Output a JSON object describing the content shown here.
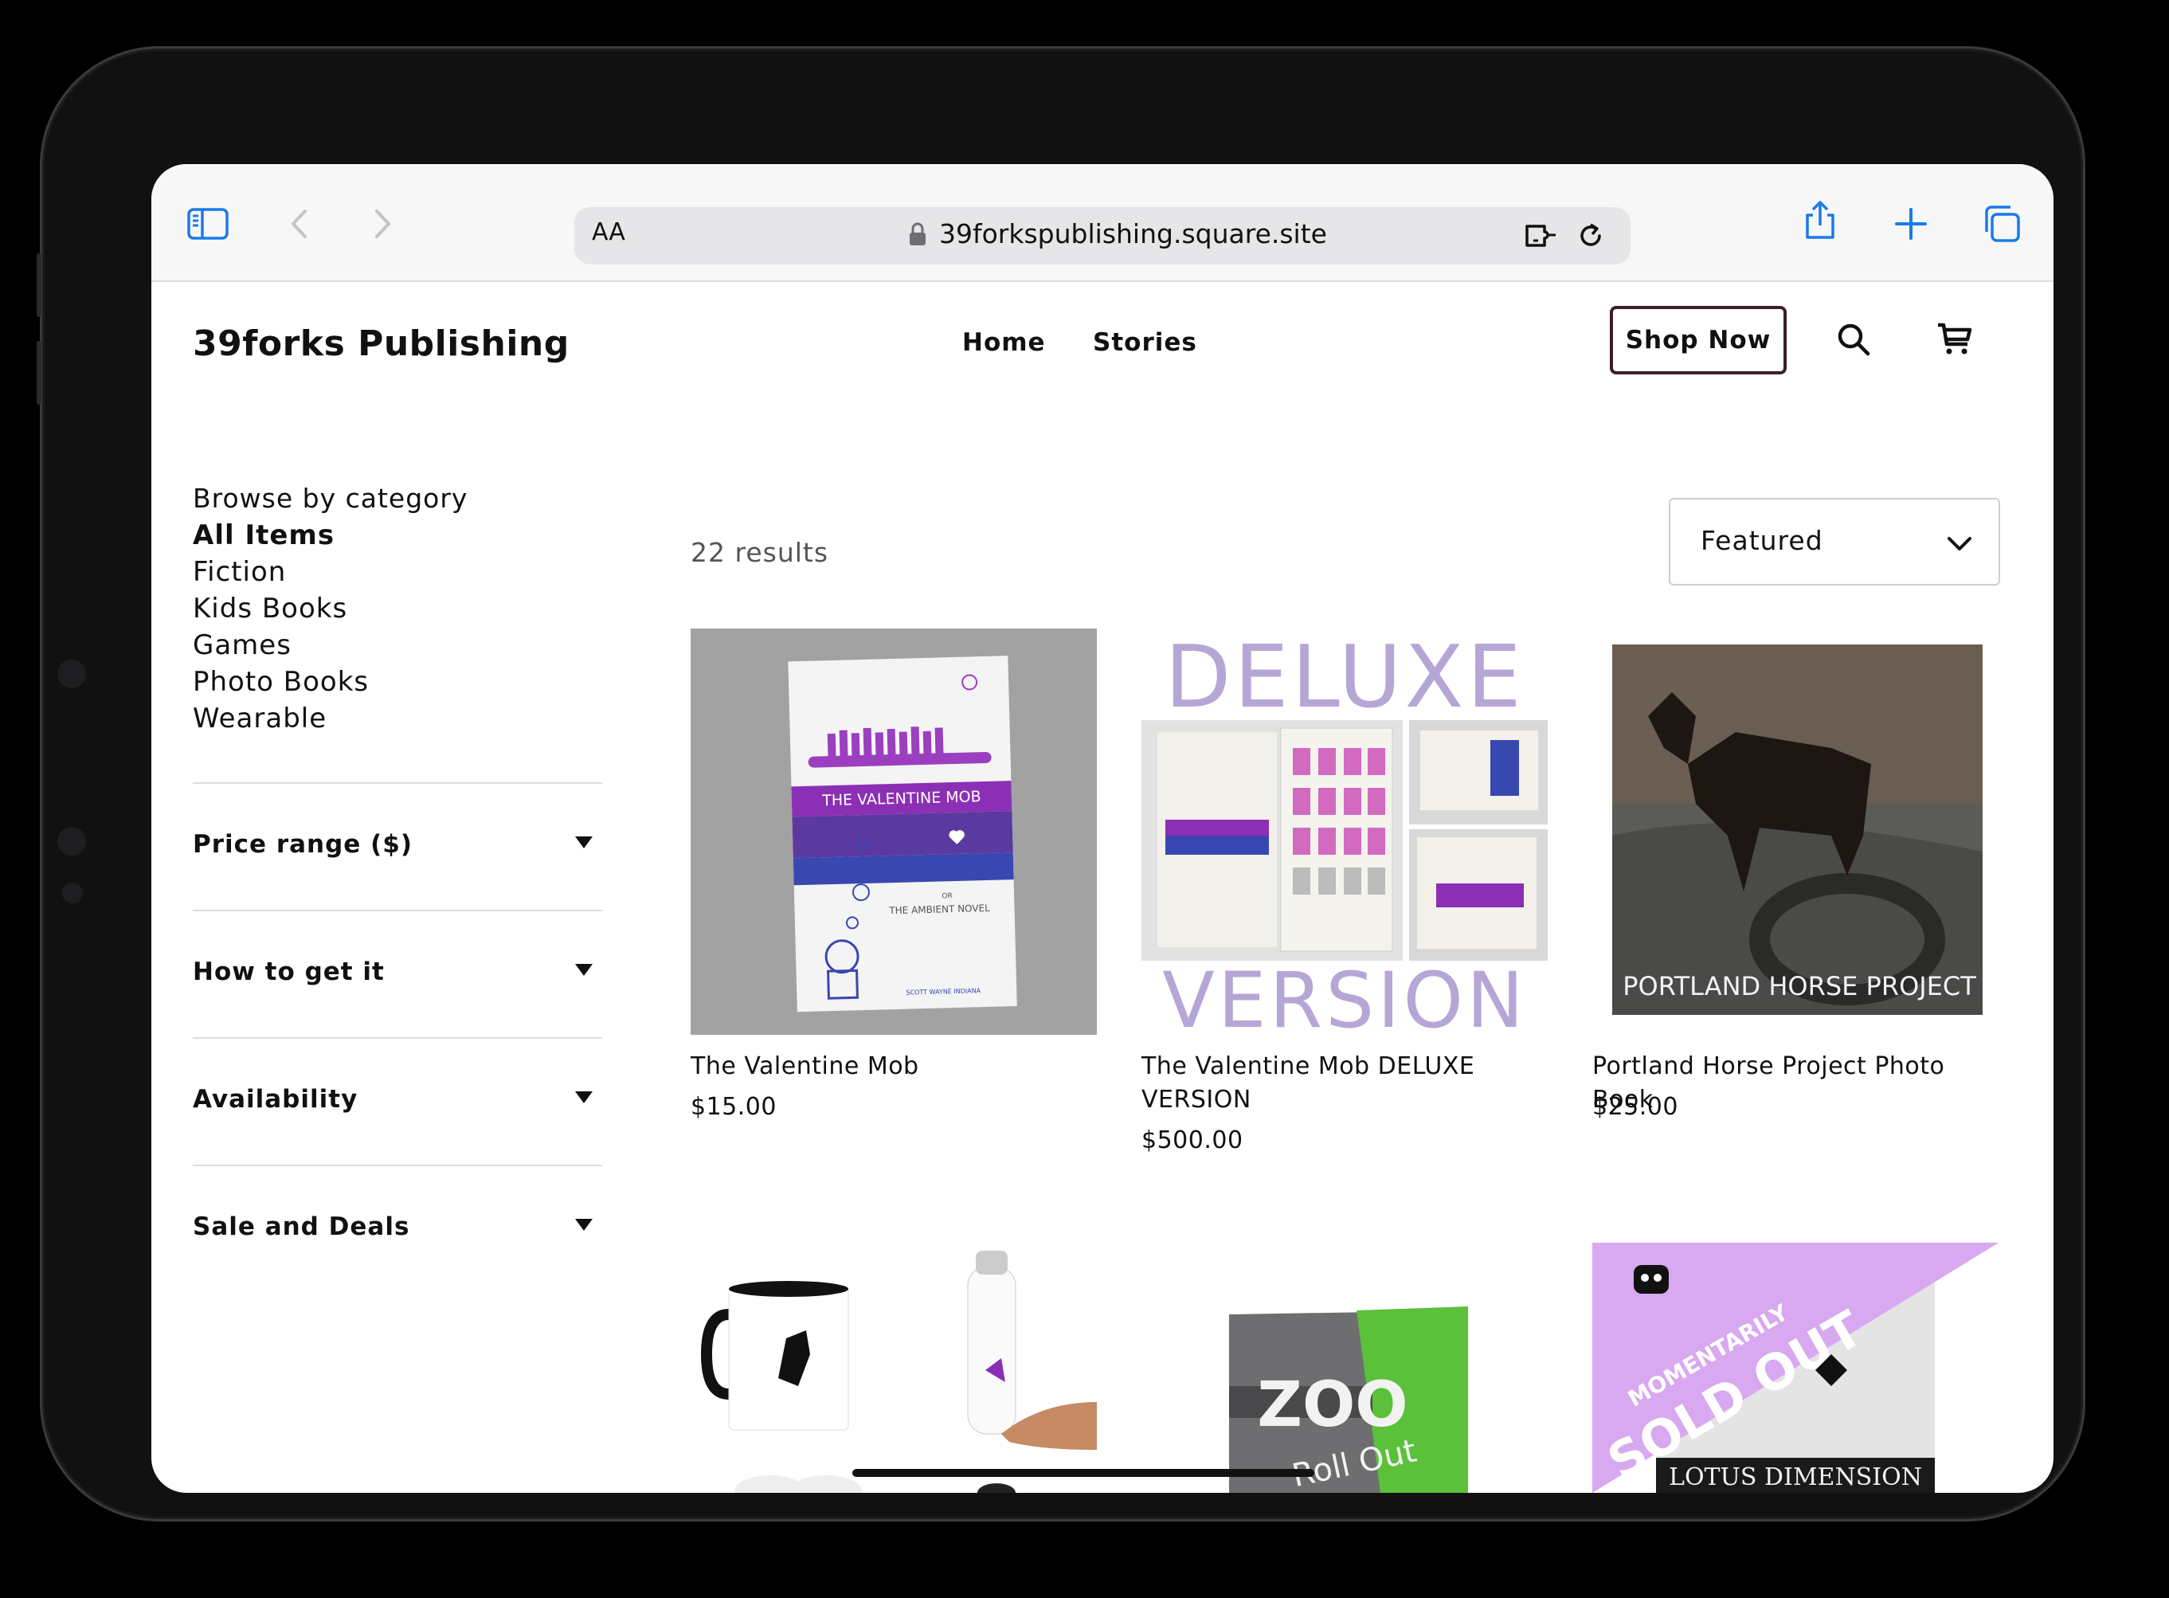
{
  "browser": {
    "text_size_label": "AA",
    "url": "39forkspublishing.square.site"
  },
  "site": {
    "brand": "39forks Publishing",
    "nav": [
      "Home",
      "Stories"
    ],
    "shop_now": "Shop Now"
  },
  "sidebar": {
    "title": "Browse by category",
    "categories": [
      "All Items",
      "Fiction",
      "Kids Books",
      "Games",
      "Photo Books",
      "Wearable"
    ],
    "active_category": "All Items",
    "facets": [
      "Price range ($)",
      "How to get it",
      "Availability",
      "Sale and Deals"
    ]
  },
  "listing": {
    "results_count": "22 results",
    "sort_value": "Featured",
    "products": [
      {
        "name": "The Valentine Mob",
        "price": "$15.00"
      },
      {
        "name": "The Valentine Mob DELUXE VERSION",
        "price": "$500.00"
      },
      {
        "name": "Portland Horse Project Photo Book",
        "price": "$25.00"
      }
    ],
    "image_text": {
      "book_title": "THE VALENTINE MOB",
      "book_or": "OR",
      "book_subtitle": "THE AMBIENT NOVEL",
      "book_author": "SCOTT WAYNE INDIANA",
      "deluxe_top": "DELUXE",
      "deluxe_bottom": "VERSION",
      "horse_caption": "PORTLAND HORSE PROJECT",
      "zoo_title": "ZOO",
      "zoo_sub": "Roll Out",
      "sold_out_1": "MOMENTARILY",
      "sold_out_2": "SOLD OUT",
      "lotus": "LOTUS DIMENSION"
    }
  },
  "colors": {
    "accent_blue": "#1a7ae8",
    "shop_border": "#3a1f25",
    "deluxe_purple": "#b6a6d6",
    "sold_out_purple": "#d8a8f0"
  }
}
